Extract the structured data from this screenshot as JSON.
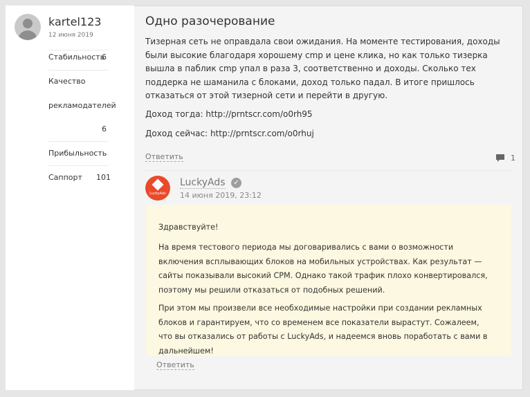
{
  "user": {
    "name": "kartel123",
    "date": "12 июня 2019",
    "avatar_icon": "user-placeholder-icon"
  },
  "ratings": [
    {
      "label": "Стабильность",
      "value": "6"
    },
    {
      "label_line1": "Качество",
      "label_line2": "рекламодателей",
      "value": "6"
    },
    {
      "label": "Прибыльность",
      "value": ""
    },
    {
      "label": "Саппорт",
      "value": "101"
    }
  ],
  "review": {
    "title": "Одно разочерование",
    "text": "Тизерная сеть не оправдала свои ожидания. На моменте тестирования, доходы были высокие благодаря хорошему cmp и цене клика, но как только тизерка вышла в паблик cmp упал в раза 3, соответственно и доходы. Сколько тех поддерка не шаманила с блоками, доход только падал. В итоге пришлось отказаться от этой тизерной сети и перейти в другую.",
    "income_then": "Доход тогда: http://prntscr.com/o0rh95",
    "income_now": "Доход сейчас: http://prntscr.com/o0rhuj",
    "reply_label": "Ответить",
    "comments_count": "1",
    "comment_icon": "comment-bubble-icon"
  },
  "answer": {
    "company": "LuckyAds",
    "logo_text": "LuckyAds",
    "verified_icon": "verified-check-icon",
    "date": "14 июня 2019, 23:12",
    "greeting": "Здравствуйте!",
    "paragraph1": "На время тестового периода мы договаривались с вами о возможности включения всплывающих блоков на мобильных устройствах. Как результат — сайты показывали высокий CPM. Однако такой трафик плохо конвертировался, поэтому мы решили отказаться от подобных решений.",
    "paragraph2": "При этом мы произвели все необходимые настройки при создании рекламных блоков и гарантируем, что со временем все показатели вырастут. Сожалеем, что вы отказались от работы с LuckyAds, и надеемся вновь поработать с вами в дальнейшем!",
    "reply_label": "Ответить"
  },
  "colors": {
    "brand": "#ea4a2a",
    "answer_bg": "#fdf8e1",
    "sidebar_bg": "#ffffff",
    "content_bg": "#f4f4f4"
  }
}
